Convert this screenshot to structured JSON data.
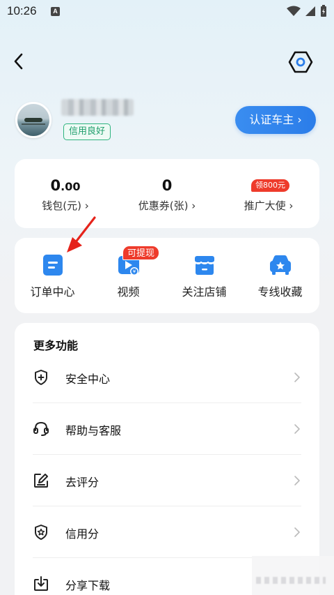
{
  "status_bar": {
    "time": "10:26",
    "notification_letter": "A"
  },
  "profile": {
    "credit_badge": "信用良好",
    "verify_button": "认证车主 ›"
  },
  "wallet": [
    {
      "value_main": "0",
      "value_decimal": ".00",
      "label": "钱包(元) ›"
    },
    {
      "value_main": "0",
      "value_decimal": "",
      "label": "优惠券(张) ›"
    },
    {
      "badge": "领800元",
      "label": "推广大使 ›"
    }
  ],
  "functions": [
    {
      "label": "订单中心",
      "icon": "order-icon",
      "color": "#2d87ee"
    },
    {
      "label": "视频",
      "icon": "video-icon",
      "color": "#2d87ee",
      "badge": "可提现"
    },
    {
      "label": "关注店铺",
      "icon": "store-icon",
      "color": "#2d87ee"
    },
    {
      "label": "专线收藏",
      "icon": "truck-star-icon",
      "color": "#2d87ee"
    }
  ],
  "more": {
    "title": "更多功能",
    "items": [
      {
        "label": "安全中心",
        "icon": "shield-plus-icon"
      },
      {
        "label": "帮助与客服",
        "icon": "headset-icon"
      },
      {
        "label": "去评分",
        "icon": "edit-icon"
      },
      {
        "label": "信用分",
        "icon": "shield-star-icon"
      },
      {
        "label": "分享下载",
        "icon": "download-icon"
      }
    ]
  },
  "colors": {
    "accent": "#2b7de9",
    "badge_red": "#ee3b2b",
    "credit_green": "#1e9e6b"
  }
}
